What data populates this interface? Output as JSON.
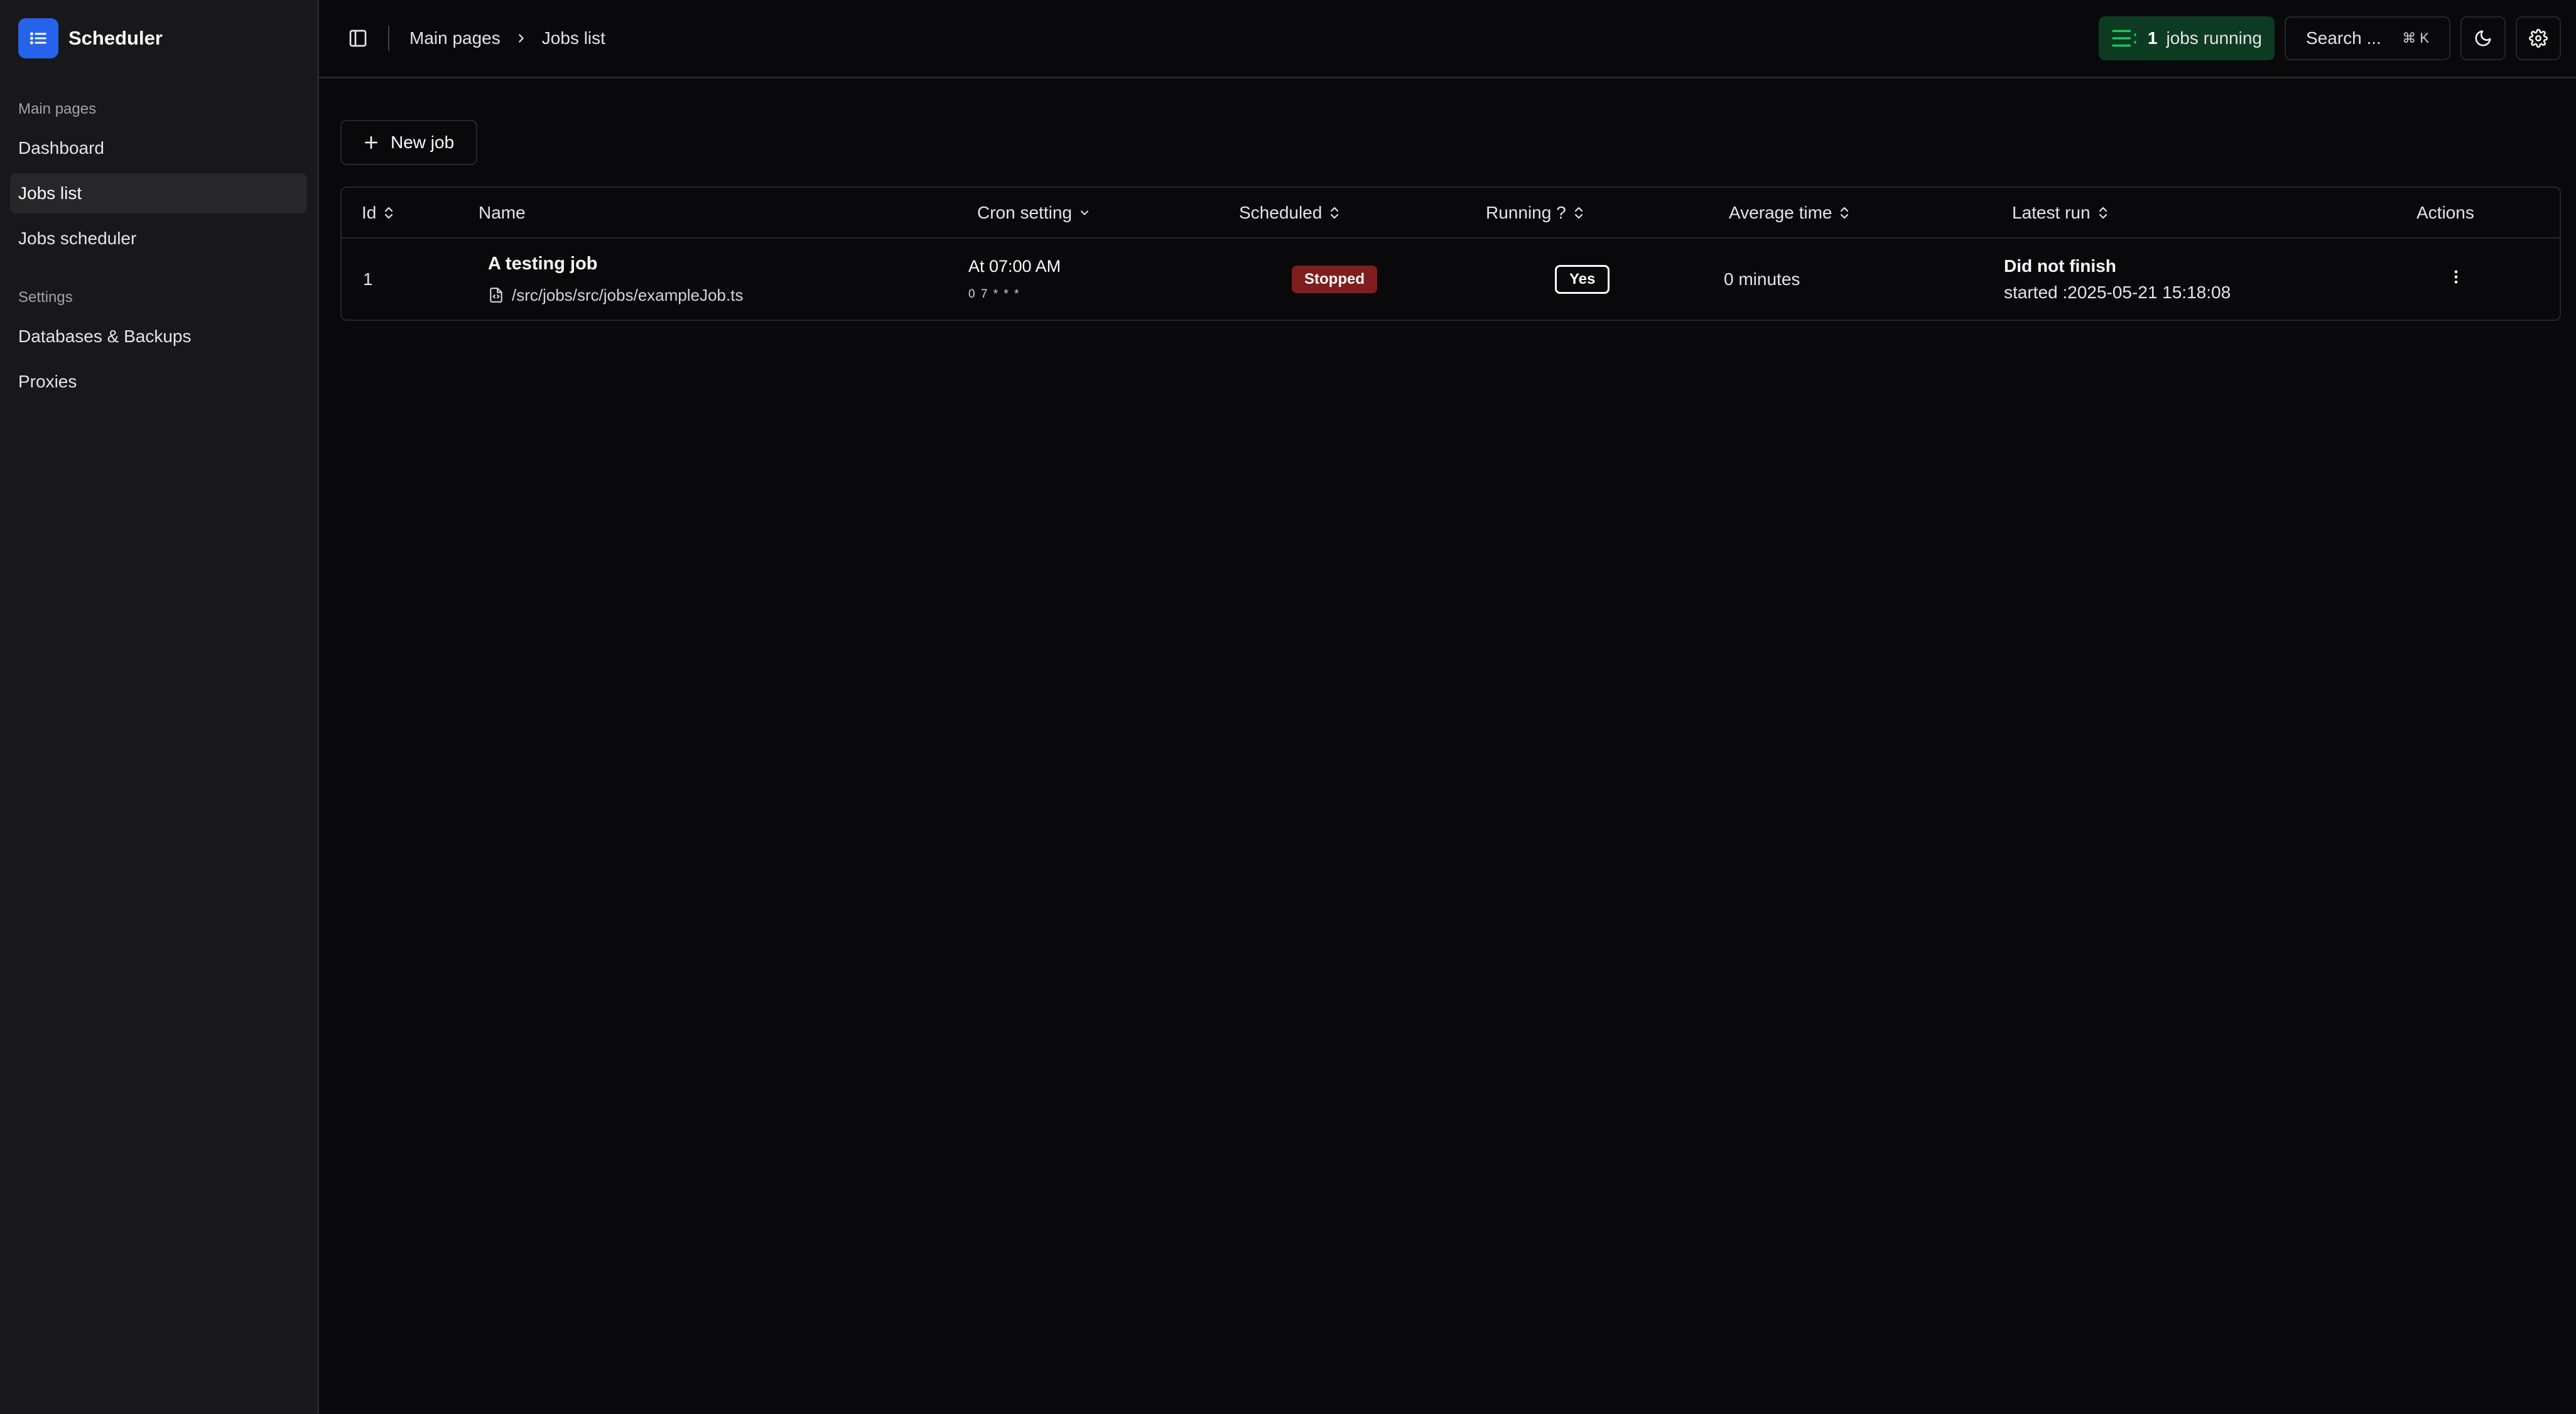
{
  "app": {
    "name": "Scheduler",
    "brand_color": "#2563eb"
  },
  "sidebar": {
    "groups": [
      {
        "label": "Main pages",
        "items": [
          {
            "label": "Dashboard",
            "active": false
          },
          {
            "label": "Jobs list",
            "active": true
          },
          {
            "label": "Jobs scheduler",
            "active": false
          }
        ]
      },
      {
        "label": "Settings",
        "items": [
          {
            "label": "Databases & Backups",
            "active": false
          },
          {
            "label": "Proxies",
            "active": false
          }
        ]
      }
    ]
  },
  "topbar": {
    "breadcrumb": [
      "Main pages",
      "Jobs list"
    ],
    "jobs_running": {
      "count": "1",
      "label": "jobs running",
      "icon": "list-running-icon",
      "color": "#22c55e"
    },
    "search": {
      "label": "Search ...",
      "shortcut": "⌘ K"
    },
    "theme_icon": "moon-icon",
    "settings_icon": "gear-icon"
  },
  "main": {
    "new_job_label": "New job",
    "table": {
      "columns": [
        "Id",
        "Name",
        "Cron setting",
        "Scheduled",
        "Running ?",
        "Average time",
        "Latest run",
        "Actions"
      ],
      "rows": [
        {
          "id": "1",
          "name": "A testing job",
          "path": "/src/jobs/src/jobs/exampleJob.ts",
          "cron_text": "At 07:00 AM",
          "cron_expr": "0 7 * * *",
          "scheduled": "Stopped",
          "running": "Yes",
          "average_time": "0 minutes",
          "latest_run_status": "Did not finish",
          "latest_run_started": "started :2025-05-21 15:18:08"
        }
      ]
    }
  }
}
